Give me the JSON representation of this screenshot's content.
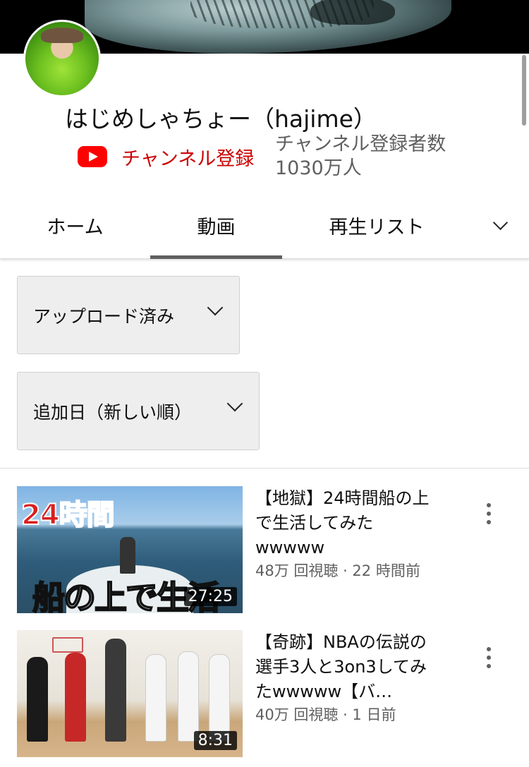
{
  "channel": {
    "name": "はじめしゃちょー（hajime）",
    "subscribe_label": "チャンネル登録",
    "subscriber_count_label": "チャンネル登録者数",
    "subscriber_count": "1030万人"
  },
  "tabs": [
    {
      "label": "ホーム",
      "selected": false
    },
    {
      "label": "動画",
      "selected": true
    },
    {
      "label": "再生リスト",
      "selected": false
    }
  ],
  "filters": {
    "type": "アップロード済み",
    "sort": "追加日（新しい順）"
  },
  "videos": [
    {
      "title": "【地獄】24時間船の上で生活してみたwwwww",
      "meta": "48万 回視聴 · 22 時間前",
      "duration": "27:25",
      "thumb_text_top": "24時間",
      "thumb_text_bottom": "船の上で生活"
    },
    {
      "title": "【奇跡】NBAの伝説の選手3人と3on3してみたwwwww【バ…",
      "meta": "40万 回視聴 · 1 日前",
      "duration": "8:31"
    }
  ],
  "colors": {
    "subscribe_red": "#cc0000",
    "youtube_red": "#ff0000",
    "secondary_text": "#606060"
  },
  "icons": {
    "subscribe": "youtube-logo-icon",
    "tab_overflow": "chevron-down-icon",
    "dropdown": "chevron-down-icon",
    "video_menu": "more-vert-icon"
  }
}
